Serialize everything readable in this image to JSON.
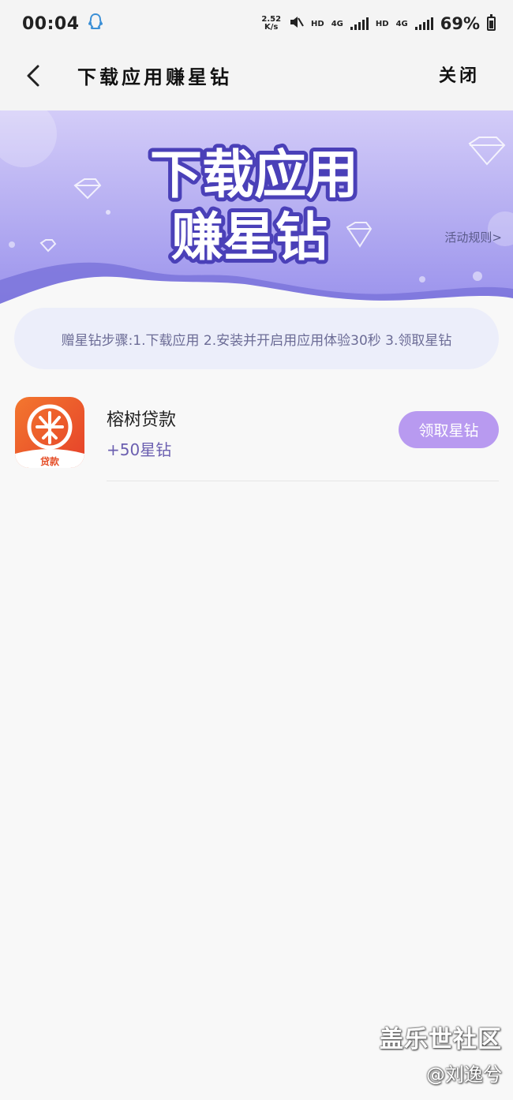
{
  "status_bar": {
    "time": "00:04",
    "net_speed_value": "2.52",
    "net_speed_unit": "K/s",
    "hd1": "HD",
    "net1": "4G",
    "hd2": "HD",
    "net2": "4G",
    "battery": "69%",
    "battery_level": 0.69
  },
  "nav": {
    "title": "下载应用赚星钻",
    "close": "关闭"
  },
  "banner": {
    "line1": "下载应用",
    "line2": "赚星钻",
    "rules_link": "活动规则>",
    "colors": {
      "top": "#cfc7f7",
      "bottom": "#8f86e8",
      "wave": "#7b74da"
    }
  },
  "steps": {
    "text": "赠星钻步骤:1.下载应用 2.安装并开启用应用体验30秒 3.领取星钻"
  },
  "apps": [
    {
      "name": "榕树贷款",
      "reward": "+50星钻",
      "icon_label": "贷款",
      "button": "领取星钻"
    }
  ],
  "watermark": {
    "main": "盖乐世社区",
    "sub": "@刘逸兮"
  },
  "colors": {
    "accent": "#b89af0",
    "reward_text": "#6b5fb0",
    "steps_bg": "#eceefa",
    "app_icon_top": "#f06a2e",
    "app_icon_bottom": "#e8452a"
  }
}
